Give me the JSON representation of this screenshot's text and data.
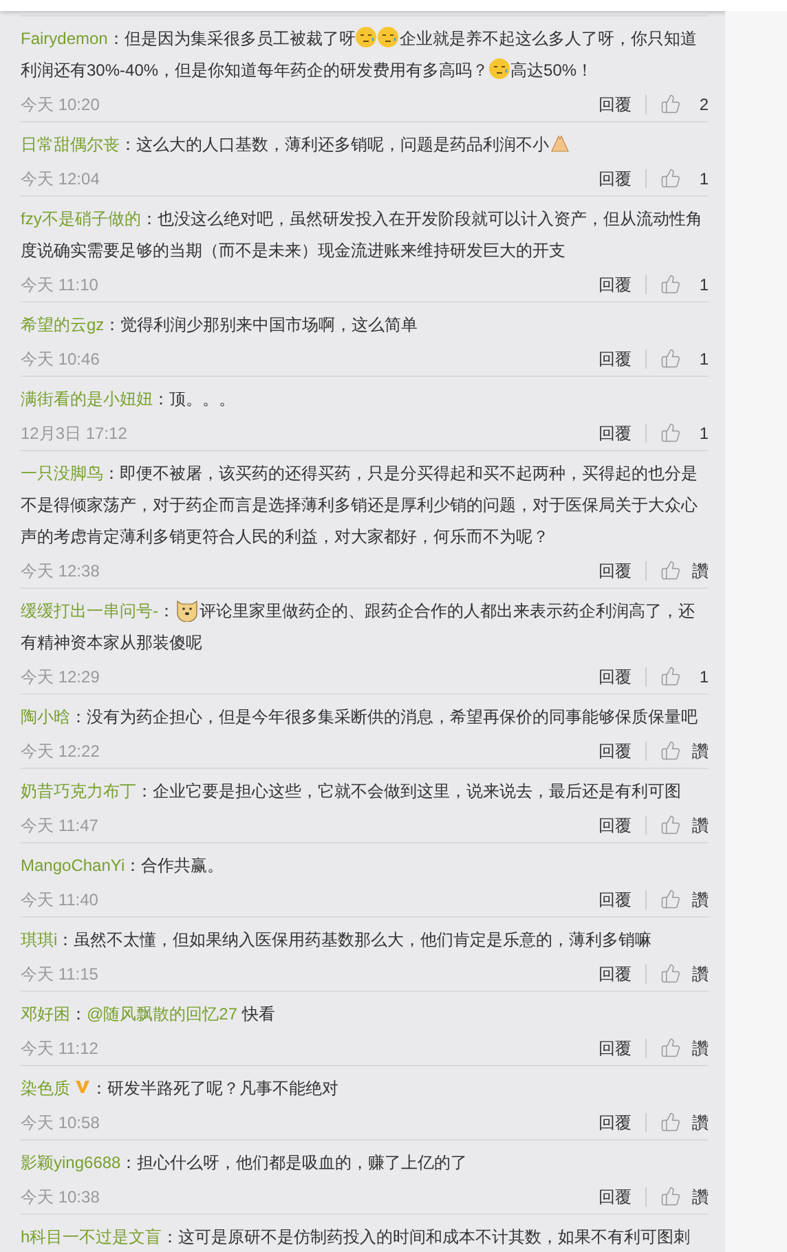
{
  "comments": [
    {
      "user": "Fairydemon",
      "verified": false,
      "separator": "：",
      "body": [
        {
          "kind": "text",
          "text": "但是因为集采很多员工被裁了呀"
        },
        {
          "kind": "sweat"
        },
        {
          "kind": "sweat"
        },
        {
          "kind": "text",
          "text": "企业就是养不起这么多人了呀，你只知道利润还有30%-40%，但是你知道每年药企的研发费用有多高吗？"
        },
        {
          "kind": "sweat"
        },
        {
          "kind": "text",
          "text": "高达50%！"
        }
      ],
      "time": "今天 10:20",
      "reply": "回覆",
      "likes": "2"
    },
    {
      "user": "日常甜偶尔丧",
      "verified": false,
      "separator": "：",
      "body": [
        {
          "kind": "text",
          "text": "这么大的人口基数，薄利还多销呢，问题是药品利润不小"
        },
        {
          "kind": "hands"
        }
      ],
      "time": "今天 12:04",
      "reply": "回覆",
      "likes": "1"
    },
    {
      "user": "fzy不是硝子做的",
      "verified": false,
      "separator": "：",
      "body": [
        {
          "kind": "text",
          "text": "也没这么绝对吧，虽然研发投入在开发阶段就可以计入资产，但从流动性角度说确实需要足够的当期（而不是未来）现金流进账来维持研发巨大的开支"
        }
      ],
      "time": "今天 11:10",
      "reply": "回覆",
      "likes": "1"
    },
    {
      "user": "希望的云gz",
      "verified": false,
      "separator": "：",
      "body": [
        {
          "kind": "text",
          "text": "觉得利润少那别来中国市场啊，这么简单"
        }
      ],
      "time": "今天 10:46",
      "reply": "回覆",
      "likes": "1"
    },
    {
      "user": "满街看的是小妞妞",
      "verified": false,
      "separator": "：",
      "body": [
        {
          "kind": "text",
          "text": "顶。。。"
        }
      ],
      "time": "12月3日 17:12",
      "reply": "回覆",
      "likes": "1"
    },
    {
      "user": "一只没脚鸟",
      "verified": false,
      "separator": "：",
      "body": [
        {
          "kind": "text",
          "text": "即便不被屠，该买药的还得买药，只是分买得起和买不起两种，买得起的也分是不是得倾家荡产，对于药企而言是选择薄利多销还是厚利少销的问题，对于医保局关于大众心声的考虑肯定薄利多销更符合人民的利益，对大家都好，何乐而不为呢？"
        }
      ],
      "time": "今天 12:38",
      "reply": "回覆",
      "likes": "讚"
    },
    {
      "user": "缓缓打出一串问号-",
      "verified": false,
      "separator": "：",
      "body": [
        {
          "kind": "dog"
        },
        {
          "kind": "text",
          "text": "评论里家里做药企的、跟药企合作的人都出来表示药企利润高了，还有精神资本家从那装傻呢"
        }
      ],
      "time": "今天 12:29",
      "reply": "回覆",
      "likes": "1"
    },
    {
      "user": "陶小晗",
      "verified": false,
      "separator": "：",
      "body": [
        {
          "kind": "text",
          "text": "没有为药企担心，但是今年很多集采断供的消息，希望再保价的同事能够保质保量吧"
        }
      ],
      "time": "今天 12:22",
      "reply": "回覆",
      "likes": "讚"
    },
    {
      "user": "奶昔巧克力布丁",
      "verified": false,
      "separator": "：",
      "body": [
        {
          "kind": "text",
          "text": "企业它要是担心这些，它就不会做到这里，说来说去，最后还是有利可图"
        }
      ],
      "time": "今天 11:47",
      "reply": "回覆",
      "likes": "讚"
    },
    {
      "user": "MangoChanYi",
      "verified": false,
      "separator": "：",
      "body": [
        {
          "kind": "text",
          "text": "合作共赢。"
        }
      ],
      "time": "今天 11:40",
      "reply": "回覆",
      "likes": "讚"
    },
    {
      "user": "琪琪i",
      "verified": false,
      "separator": "：",
      "body": [
        {
          "kind": "text",
          "text": "虽然不太懂，但如果纳入医保用药基数那么大，他们肯定是乐意的，薄利多销嘛"
        }
      ],
      "time": "今天 11:15",
      "reply": "回覆",
      "likes": "讚"
    },
    {
      "user": "邓好困",
      "verified": false,
      "separator": "：",
      "body": [
        {
          "kind": "mention",
          "text": "@随风飘散的回忆27"
        },
        {
          "kind": "text",
          "text": " 快看"
        }
      ],
      "time": "今天 11:12",
      "reply": "回覆",
      "likes": "讚"
    },
    {
      "user": "染色质",
      "verified": true,
      "separator": "：",
      "body": [
        {
          "kind": "text",
          "text": "研发半路死了呢？凡事不能绝对"
        }
      ],
      "time": "今天 10:58",
      "reply": "回覆",
      "likes": "讚"
    },
    {
      "user": "影颖ying6688",
      "verified": false,
      "separator": "：",
      "body": [
        {
          "kind": "text",
          "text": "担心什么呀，他们都是吸血的，赚了上亿的了"
        }
      ],
      "time": "今天 10:38",
      "reply": "回覆",
      "likes": "讚"
    },
    {
      "user": "h科目一不过是文盲",
      "verified": false,
      "separator": "：",
      "body": [
        {
          "kind": "text",
          "text": "这可是原研不是仿制药投入的时间和成本不计其数，如果不有利可图刺"
        }
      ]
    }
  ]
}
